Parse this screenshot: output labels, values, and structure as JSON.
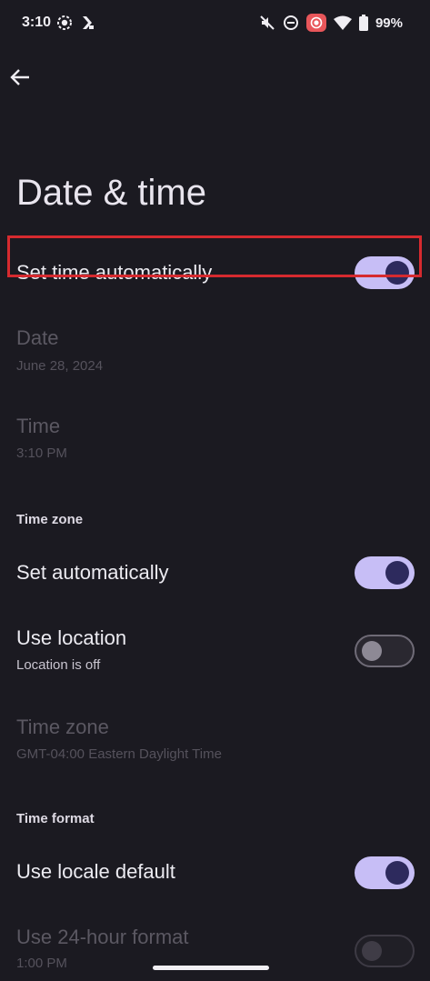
{
  "status_bar": {
    "time": "3:10",
    "battery": "99%",
    "icons_left": [
      "screen-record-icon",
      "app-notification-icon"
    ],
    "icons_right": [
      "mute-vibrate-off-icon",
      "do-not-disturb-icon",
      "screen-record-active-icon",
      "wifi-icon",
      "battery-icon"
    ]
  },
  "header": {
    "title": "Date & time"
  },
  "settings": {
    "set_time_auto": {
      "title": "Set time automatically",
      "on": true
    },
    "date": {
      "title": "Date",
      "summary": "June 28, 2024"
    },
    "time": {
      "title": "Time",
      "summary": "3:10 PM"
    },
    "time_zone_section": {
      "header": "Time zone"
    },
    "tz_set_auto": {
      "title": "Set automatically",
      "on": true
    },
    "use_location": {
      "title": "Use location",
      "summary": "Location is off",
      "on": false
    },
    "time_zone": {
      "title": "Time zone",
      "summary": "GMT-04:00 Eastern Daylight Time"
    },
    "time_format_section": {
      "header": "Time format"
    },
    "use_locale_default": {
      "title": "Use locale default",
      "on": true
    },
    "use_24h": {
      "title": "Use 24-hour format",
      "summary": "1:00 PM",
      "on": false
    }
  },
  "colors": {
    "background": "#1b1a21",
    "switch_on_track": "#c7bef6",
    "switch_on_thumb": "#2d2a5d",
    "highlight": "#d62a2f"
  }
}
